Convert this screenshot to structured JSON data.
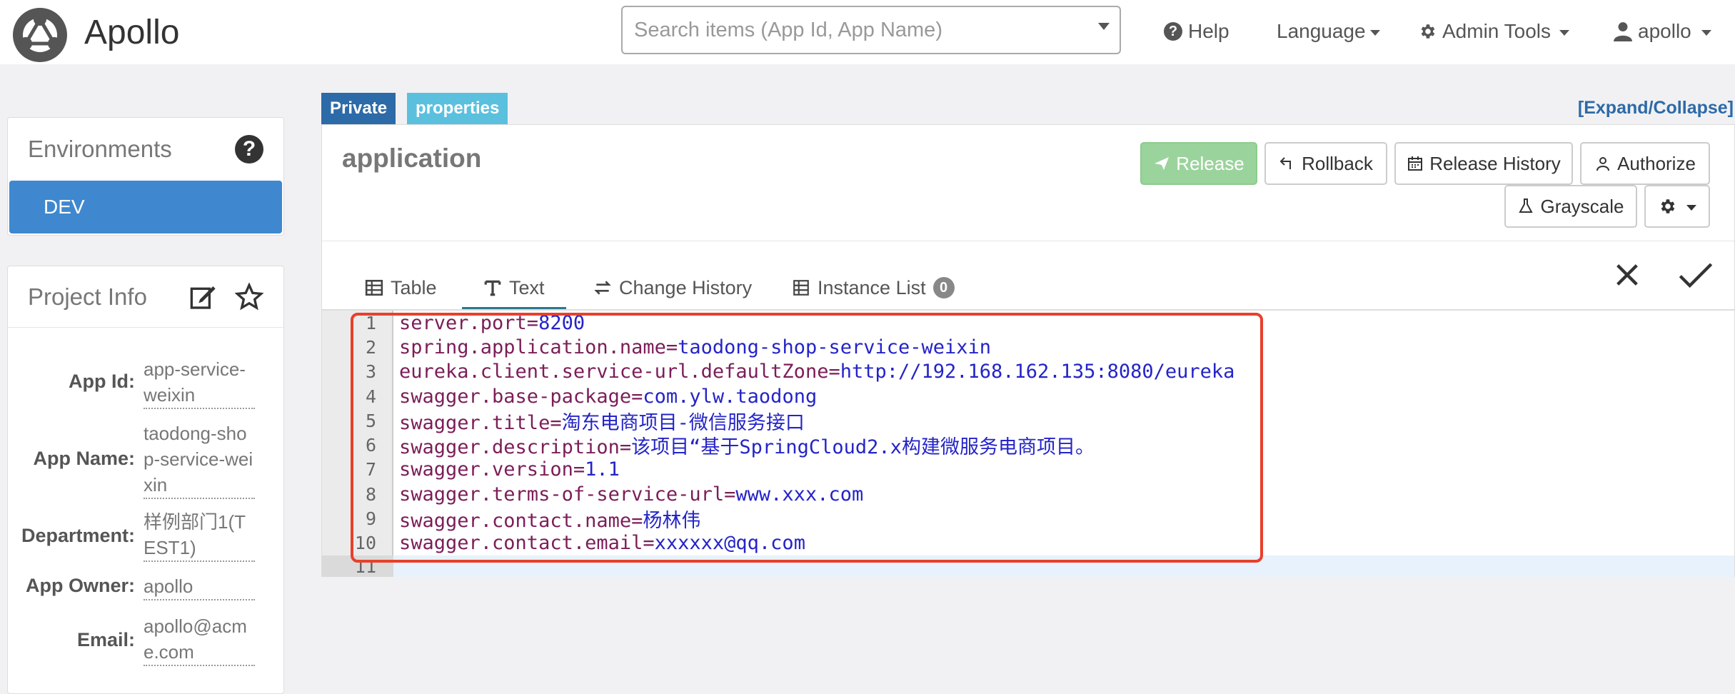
{
  "header": {
    "logo_text": "Apollo",
    "search_placeholder": "Search items (App Id, App Name)",
    "help_label": "Help",
    "language_label": "Language",
    "admin_tools_label": "Admin Tools",
    "user_label": "apollo"
  },
  "sidebar": {
    "environments_title": "Environments",
    "env_items": [
      "DEV"
    ],
    "project_info_title": "Project Info",
    "info": [
      {
        "label": "App Id:",
        "value": "app-service-weixin"
      },
      {
        "label": "App Name:",
        "value": "taodong-shop-service-weixin"
      },
      {
        "label": "Department:",
        "value": "样例部门1(TEST1)"
      },
      {
        "label": "App Owner:",
        "value": "apollo"
      },
      {
        "label": "Email:",
        "value": "apollo@acme.com"
      }
    ]
  },
  "namespace": {
    "badges": {
      "private": "Private",
      "format": "properties"
    },
    "expand_collapse": "[Expand/Collapse]",
    "title": "application",
    "buttons": {
      "release": "Release",
      "rollback": "Rollback",
      "release_history": "Release History",
      "authorize": "Authorize",
      "grayscale": "Grayscale"
    },
    "tabs": {
      "table": "Table",
      "text": "Text",
      "change_history": "Change History",
      "instance_list": "Instance List",
      "instance_count": "0"
    },
    "editor_lines": [
      {
        "n": "1",
        "key": "server.port=",
        "value": "8200"
      },
      {
        "n": "2",
        "key": "spring.application.name=",
        "value": "taodong-shop-service-weixin"
      },
      {
        "n": "3",
        "key": "eureka.client.service-url.defaultZone=",
        "value": "http://192.168.162.135:8080/eureka"
      },
      {
        "n": "4",
        "key": "swagger.base-package=",
        "value": "com.ylw.taodong"
      },
      {
        "n": "5",
        "key": "swagger.title=",
        "value": "淘东电商项目-微信服务接口"
      },
      {
        "n": "6",
        "key": "swagger.description=",
        "value": "该项目“基于SpringCloud2.x构建微服务电商项目。"
      },
      {
        "n": "7",
        "key": "swagger.version=",
        "value": "1.1"
      },
      {
        "n": "8",
        "key": "swagger.terms-of-service-url=",
        "value": "www.xxx.com"
      },
      {
        "n": "9",
        "key": "swagger.contact.name=",
        "value": "杨林伟"
      },
      {
        "n": "10",
        "key": "swagger.contact.email=",
        "value": "xxxxxx@qq.com"
      },
      {
        "n": "11",
        "key": "",
        "value": ""
      }
    ]
  },
  "colors": {
    "accent_blue": "#3f88cf",
    "private_badge": "#2d6aa8",
    "properties_badge": "#5bc0de",
    "release_green": "#9bd39c",
    "highlight_red": "#e8402a",
    "code_key": "#7b1e58",
    "code_value": "#2424c8"
  }
}
